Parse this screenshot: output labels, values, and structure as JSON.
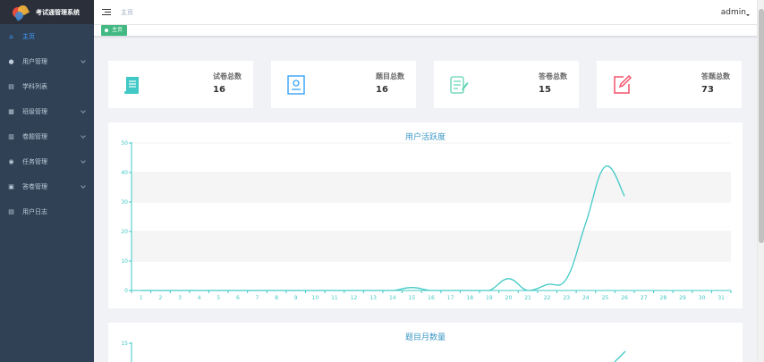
{
  "app": {
    "title": "考试通管理系统"
  },
  "sidebar": {
    "items": [
      {
        "label": "主页",
        "icon": "home-icon",
        "active": true,
        "expandable": false
      },
      {
        "label": "用户管理",
        "icon": "user-icon",
        "active": false,
        "expandable": true
      },
      {
        "label": "学科列表",
        "icon": "list-icon",
        "active": false,
        "expandable": false
      },
      {
        "label": "班级管理",
        "icon": "class-icon",
        "active": false,
        "expandable": true
      },
      {
        "label": "卷题管理",
        "icon": "book-icon",
        "active": false,
        "expandable": true
      },
      {
        "label": "任务管理",
        "icon": "task-icon",
        "active": false,
        "expandable": true
      },
      {
        "label": "答卷管理",
        "icon": "answer-icon",
        "active": false,
        "expandable": true
      },
      {
        "label": "用户日志",
        "icon": "log-icon",
        "active": false,
        "expandable": false
      }
    ]
  },
  "header": {
    "breadcrumb": "主页",
    "user": "admin"
  },
  "tags": {
    "active": "主页"
  },
  "stats": [
    {
      "label": "试卷总数",
      "value": "16",
      "icon": "paper-scroll-icon",
      "color": "#40c9c6"
    },
    {
      "label": "题目总数",
      "value": "16",
      "icon": "question-book-icon",
      "color": "#36a3f7"
    },
    {
      "label": "答卷总数",
      "value": "15",
      "icon": "answer-sheet-icon",
      "color": "#5ed3b3"
    },
    {
      "label": "答题总数",
      "value": "73",
      "icon": "edit-note-icon",
      "color": "#f4516c"
    }
  ],
  "chart_data": [
    {
      "type": "line",
      "title": "用户活跃度",
      "x": [
        "1",
        "2",
        "3",
        "4",
        "5",
        "6",
        "7",
        "8",
        "9",
        "10",
        "11",
        "12",
        "13",
        "14",
        "15",
        "16",
        "17",
        "18",
        "19",
        "20",
        "21",
        "22",
        "23",
        "24",
        "25",
        "26",
        "27",
        "28",
        "29",
        "30",
        "31"
      ],
      "series": [
        {
          "values": [
            0,
            0,
            0,
            0,
            0,
            0,
            0,
            0,
            0,
            0,
            0,
            0,
            0,
            0,
            1,
            0,
            0,
            0,
            0,
            4,
            0,
            2,
            4,
            23,
            42,
            32
          ]
        }
      ],
      "ylim": [
        0,
        50
      ],
      "yticks": [
        "0",
        "10",
        "20",
        "30",
        "40",
        "50"
      ],
      "color": "#40c9c6",
      "grid": true
    },
    {
      "type": "line",
      "title": "题目月数量",
      "ylim": [
        0,
        15
      ],
      "yticks": [
        "15"
      ],
      "color": "#40c9c6"
    }
  ]
}
